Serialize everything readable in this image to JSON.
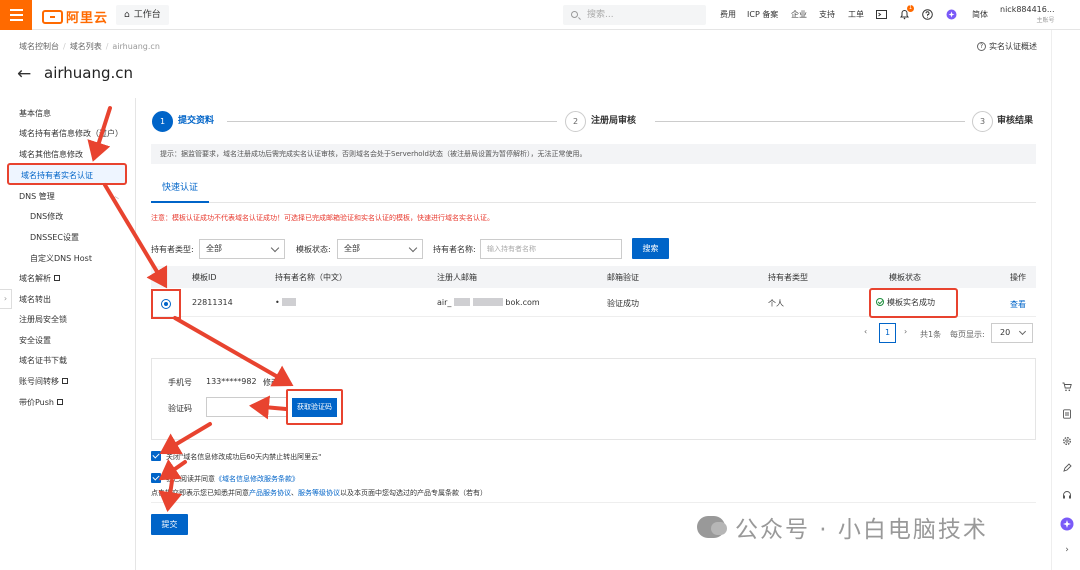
{
  "topbar": {
    "logo_text": "阿里云",
    "workbench": "工作台",
    "search_placeholder": "搜索...",
    "nav": [
      "费用",
      "ICP 备案",
      "企业",
      "支持",
      "工单"
    ],
    "lang": "简体",
    "notif_badge": "1",
    "user_name": "nick884416...",
    "user_role": "主账号"
  },
  "breadcrumb": [
    "域名控制台",
    "域名列表",
    "airhuang.cn"
  ],
  "realname_overview": "实名认证概述",
  "page_title": "airhuang.cn",
  "sidebar": {
    "basic_info": "基本信息",
    "holder_modify": "域名持有者信息修改（过户）",
    "other_modify": "域名其他信息修改",
    "realname": "域名持有者实名认证",
    "dns_group": "DNS 管理",
    "dns_modify": "DNS修改",
    "dnssec": "DNSSEC设置",
    "custom_dns": "自定义DNS Host",
    "resolve": "域名解析",
    "transfer_out": "域名转出",
    "registry_lock": "注册局安全锁",
    "security": "安全设置",
    "cert_download": "域名证书下载",
    "account_transfer": "账号间转移",
    "push": "带价Push"
  },
  "steps": [
    {
      "num": "1",
      "label": "提交资料"
    },
    {
      "num": "2",
      "label": "注册局审核"
    },
    {
      "num": "3",
      "label": "审核结果"
    }
  ],
  "tip": "提示：据监管要求，域名注册成功后需完成实名认证审核，否则域名会处于Serverhold状态（被注册局设置为暂停解析），无法正常使用。",
  "tab_label": "快速认证",
  "notice": "注意：模板认证成功不代表域名认证成功！可选择已完成邮箱验证和实名认证的模板，快速进行域名实名认证。",
  "filters": {
    "holder_type_label": "持有者类型:",
    "holder_type_value": "全部",
    "template_status_label": "模板状态:",
    "template_status_value": "全部",
    "holder_name_label": "持有者名称:",
    "holder_name_placeholder": "输入持有者名称",
    "search_button": "搜索"
  },
  "table": {
    "headers": [
      "模板ID",
      "持有者名称（中文）",
      "注册人邮箱",
      "邮箱验证",
      "持有者类型",
      "模板状态",
      "操作"
    ],
    "row": {
      "id": "22811314",
      "name": "•",
      "email_prefix": "air_",
      "email_suffix": "bok.com",
      "email_verify": "验证成功",
      "holder_type": "个人",
      "status": "模板实名成功",
      "action": "查看"
    }
  },
  "pagination": {
    "current": "1",
    "total": "共1条",
    "per_page_label": "每页显示:",
    "per_page": "20"
  },
  "verify": {
    "phone_label": "手机号",
    "phone_value": "133*****982",
    "modify_link": "修改",
    "code_label": "验证码",
    "get_code_button": "获取验证码"
  },
  "checkbox1": "关闭\"域名信息修改成功后60天内禁止转出阿里云\"",
  "checkbox2_prefix": "我已阅读并同意",
  "checkbox2_link": "《域名信息修改服务条款》",
  "agreement_prefix": "点击提交即表示您已知悉并同意",
  "agreement_link1": "产品服务协议",
  "agreement_sep": "、",
  "agreement_link2": "服务等级协议",
  "agreement_suffix": "以及本页面中您勾选过的产品专属条款（若有）",
  "submit_button": "提交",
  "watermark": "公众号 · 小白电脑技术",
  "colors": {
    "accent": "#0064c8",
    "brand": "#ff6a00",
    "annotation": "#e8432f",
    "success": "#1e8e3e"
  }
}
